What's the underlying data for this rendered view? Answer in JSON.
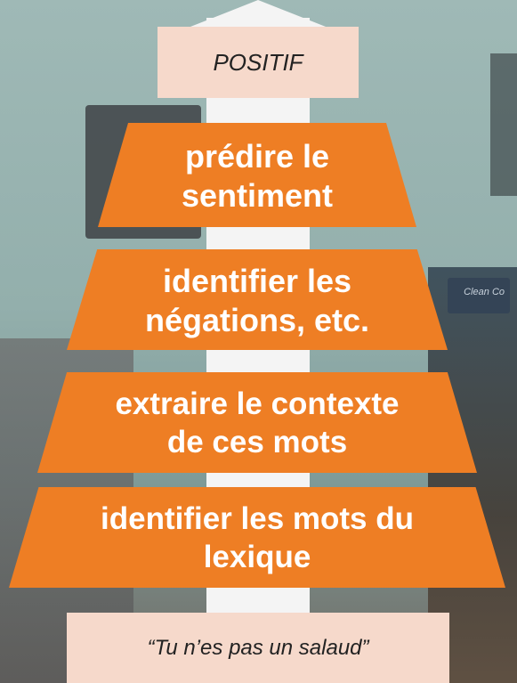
{
  "top_label": "POSITIF",
  "levels": [
    "prédire le\nsentiment",
    "identifier les\nnégations, etc.",
    "extraire le contexte\nde ces mots",
    "identifier les mots du\nlexique"
  ],
  "bottom_label": "“Tu n’es pas un salaud”",
  "colors": {
    "level_fill": "#ee7e24",
    "label_fill": "#f6d9cb",
    "arrow": "#f4f4f4"
  },
  "background": {
    "book_text": "Clean Co"
  }
}
